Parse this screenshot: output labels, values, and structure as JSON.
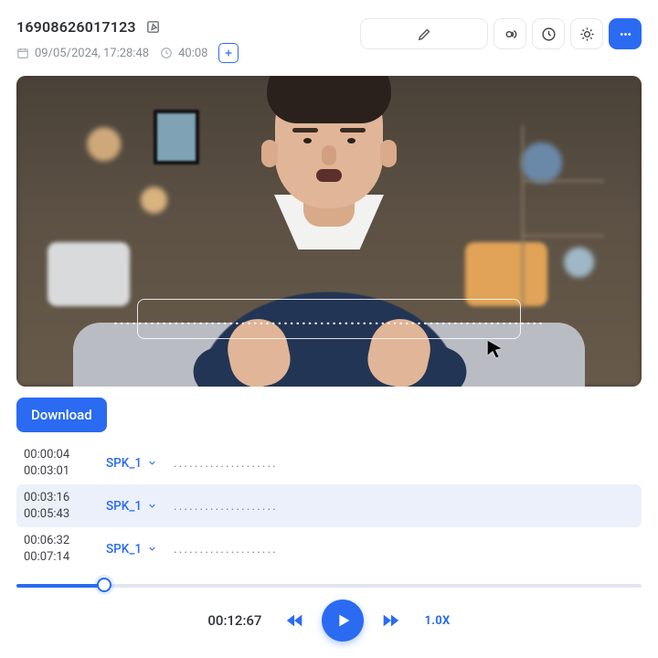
{
  "colors": {
    "accent": "#2a6bf2"
  },
  "header": {
    "title": "16908626017123",
    "date": "09/05/2024, 17:28:48",
    "duration": "40:08"
  },
  "icons": {
    "edit": "edit-icon",
    "calendar": "calendar-icon",
    "clock": "clock-icon",
    "plus": "plus-icon",
    "pen": "pen-icon",
    "voice": "voice-icon",
    "history": "history-icon",
    "sun": "sun-icon",
    "more": "more-icon",
    "cursor": "cursor-icon",
    "chevron": "chevron-down-icon",
    "rwd": "rewind-icon",
    "fwd": "forward-icon",
    "play": "play-icon"
  },
  "caption_placeholder": ".......................................................................",
  "download_label": "Download",
  "transcript": [
    {
      "start": "00:00:04",
      "end": "00:03:01",
      "speaker": "SPK_1",
      "text": "....................",
      "selected": false
    },
    {
      "start": "00:03:16",
      "end": "00:05:43",
      "speaker": "SPK_1",
      "text": "....................",
      "selected": true
    },
    {
      "start": "00:06:32",
      "end": "00:07:14",
      "speaker": "SPK_1",
      "text": "....................",
      "selected": false
    }
  ],
  "player": {
    "current_time": "00:12:67",
    "speed": "1.0X",
    "progress_pct": 14
  }
}
